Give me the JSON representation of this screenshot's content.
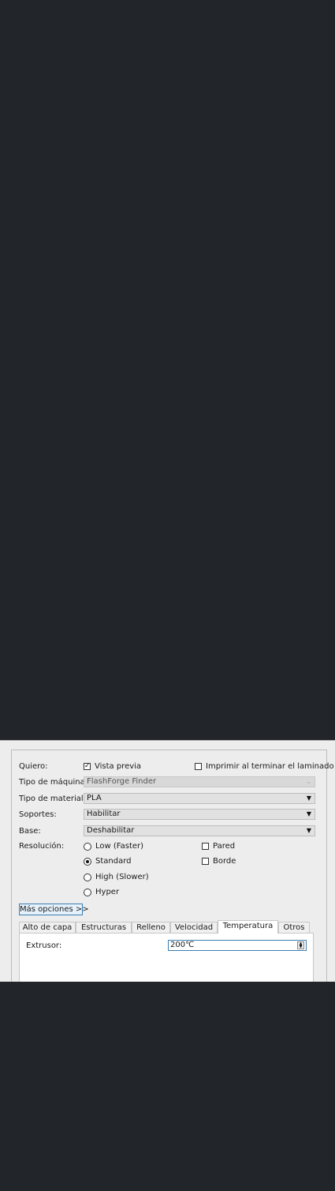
{
  "form": {
    "quiero_label": "Quiero:",
    "vista_previa": {
      "label": "Vista previa",
      "checked": true
    },
    "imprimir": {
      "label": "Imprimir al terminar el laminado",
      "checked": false
    },
    "maquina": {
      "label": "Tipo de máquina:",
      "value": "FlashForge Finder"
    },
    "material": {
      "label": "Tipo de material:",
      "value": "PLA"
    },
    "soportes": {
      "label": "Soportes:",
      "value": "Habilitar"
    },
    "base": {
      "label": "Base:",
      "value": "Deshabilitar"
    },
    "resolucion_label": "Resolución:",
    "resolutions": [
      {
        "label": "Low (Faster)",
        "selected": false
      },
      {
        "label": "Standard",
        "selected": true
      },
      {
        "label": "High (Slower)",
        "selected": false
      },
      {
        "label": "Hyper",
        "selected": false
      }
    ],
    "pared": {
      "label": "Pared",
      "checked": false
    },
    "borde": {
      "label": "Borde",
      "checked": false
    },
    "more_options": "Más opciones >>"
  },
  "tabs": [
    {
      "label": "Alto de capa",
      "active": false
    },
    {
      "label": "Estructuras",
      "active": false
    },
    {
      "label": "Relleno",
      "active": false
    },
    {
      "label": "Velocidad",
      "active": false
    },
    {
      "label": "Temperatura",
      "active": true
    },
    {
      "label": "Otros",
      "active": false
    }
  ],
  "temperatura": {
    "extrusor_label": "Extrusor:",
    "extrusor_value": "200℃"
  },
  "colors": {
    "background": "#22252a",
    "panel": "#ededed",
    "accent": "#3c7fb1"
  }
}
